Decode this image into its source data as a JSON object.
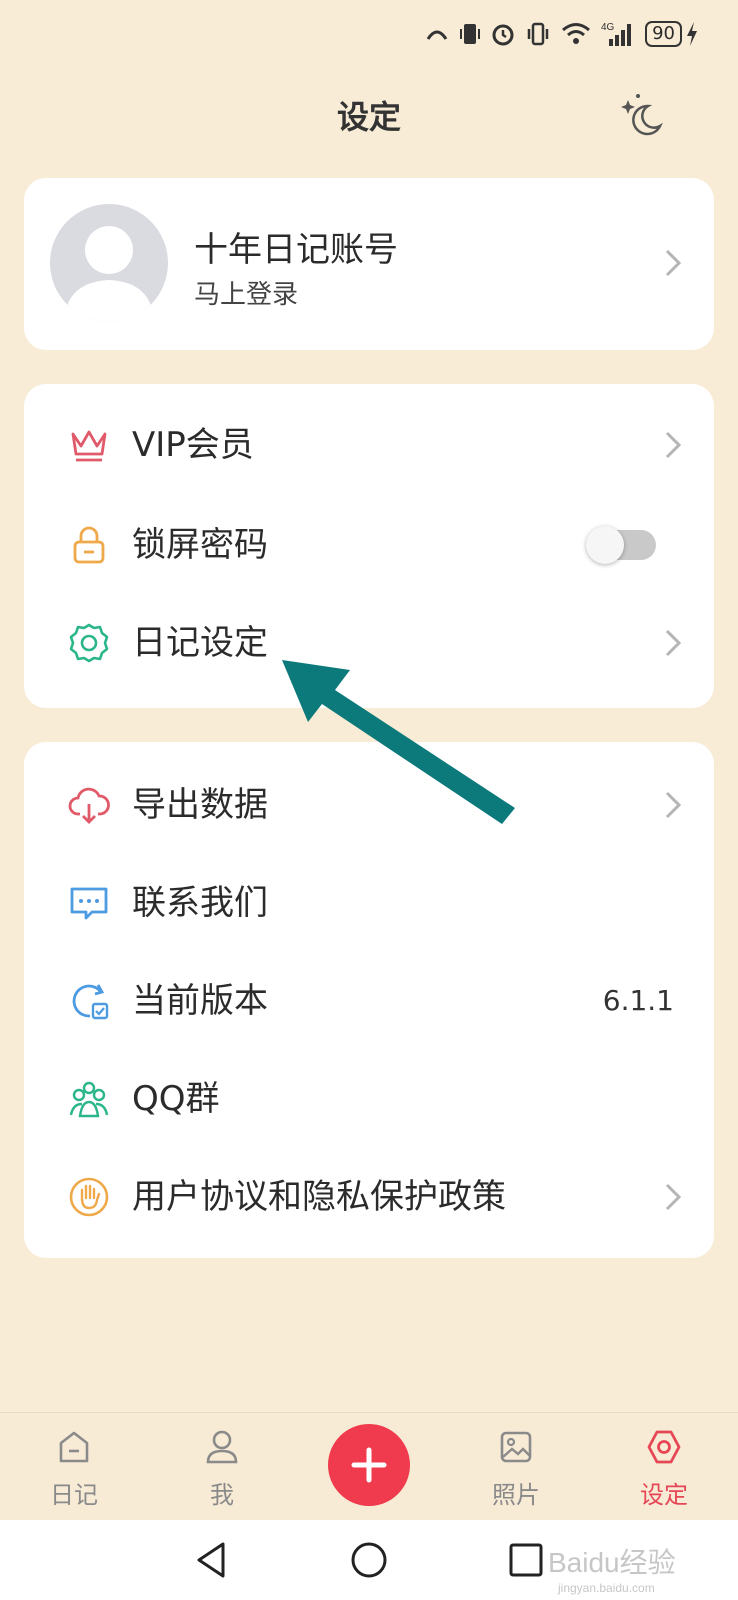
{
  "status_bar": {
    "battery": "90",
    "network": "4G"
  },
  "header": {
    "title": "设定"
  },
  "profile": {
    "name": "十年日记账号",
    "subtitle": "马上登录"
  },
  "group1": {
    "items": [
      {
        "label": "VIP会员",
        "icon": "crown-icon"
      },
      {
        "label": "锁屏密码",
        "icon": "lock-icon",
        "toggle": false
      },
      {
        "label": "日记设定",
        "icon": "gear-icon"
      }
    ]
  },
  "group2": {
    "items": [
      {
        "label": "导出数据",
        "icon": "cloud-download-icon"
      },
      {
        "label": "联系我们",
        "icon": "chat-icon"
      },
      {
        "label": "当前版本",
        "icon": "refresh-check-icon",
        "value": "6.1.1"
      },
      {
        "label": "QQ群",
        "icon": "group-icon"
      },
      {
        "label": "用户协议和隐私保护政策",
        "icon": "hand-icon"
      }
    ]
  },
  "tabbar": {
    "tabs": [
      {
        "label": "日记",
        "icon": "diary-icon"
      },
      {
        "label": "我",
        "icon": "person-icon"
      },
      {
        "label": "照片",
        "icon": "photo-icon"
      },
      {
        "label": "设定",
        "icon": "settings-icon"
      }
    ],
    "active": "设定"
  },
  "colors": {
    "accent": "#e64755",
    "add_button": "#ef3b4d",
    "background": "#f8ecd6",
    "arrow": "#0c7a7b"
  },
  "watermark": {
    "text": "Baidu经验",
    "sub": "jingyan.baidu.com"
  }
}
